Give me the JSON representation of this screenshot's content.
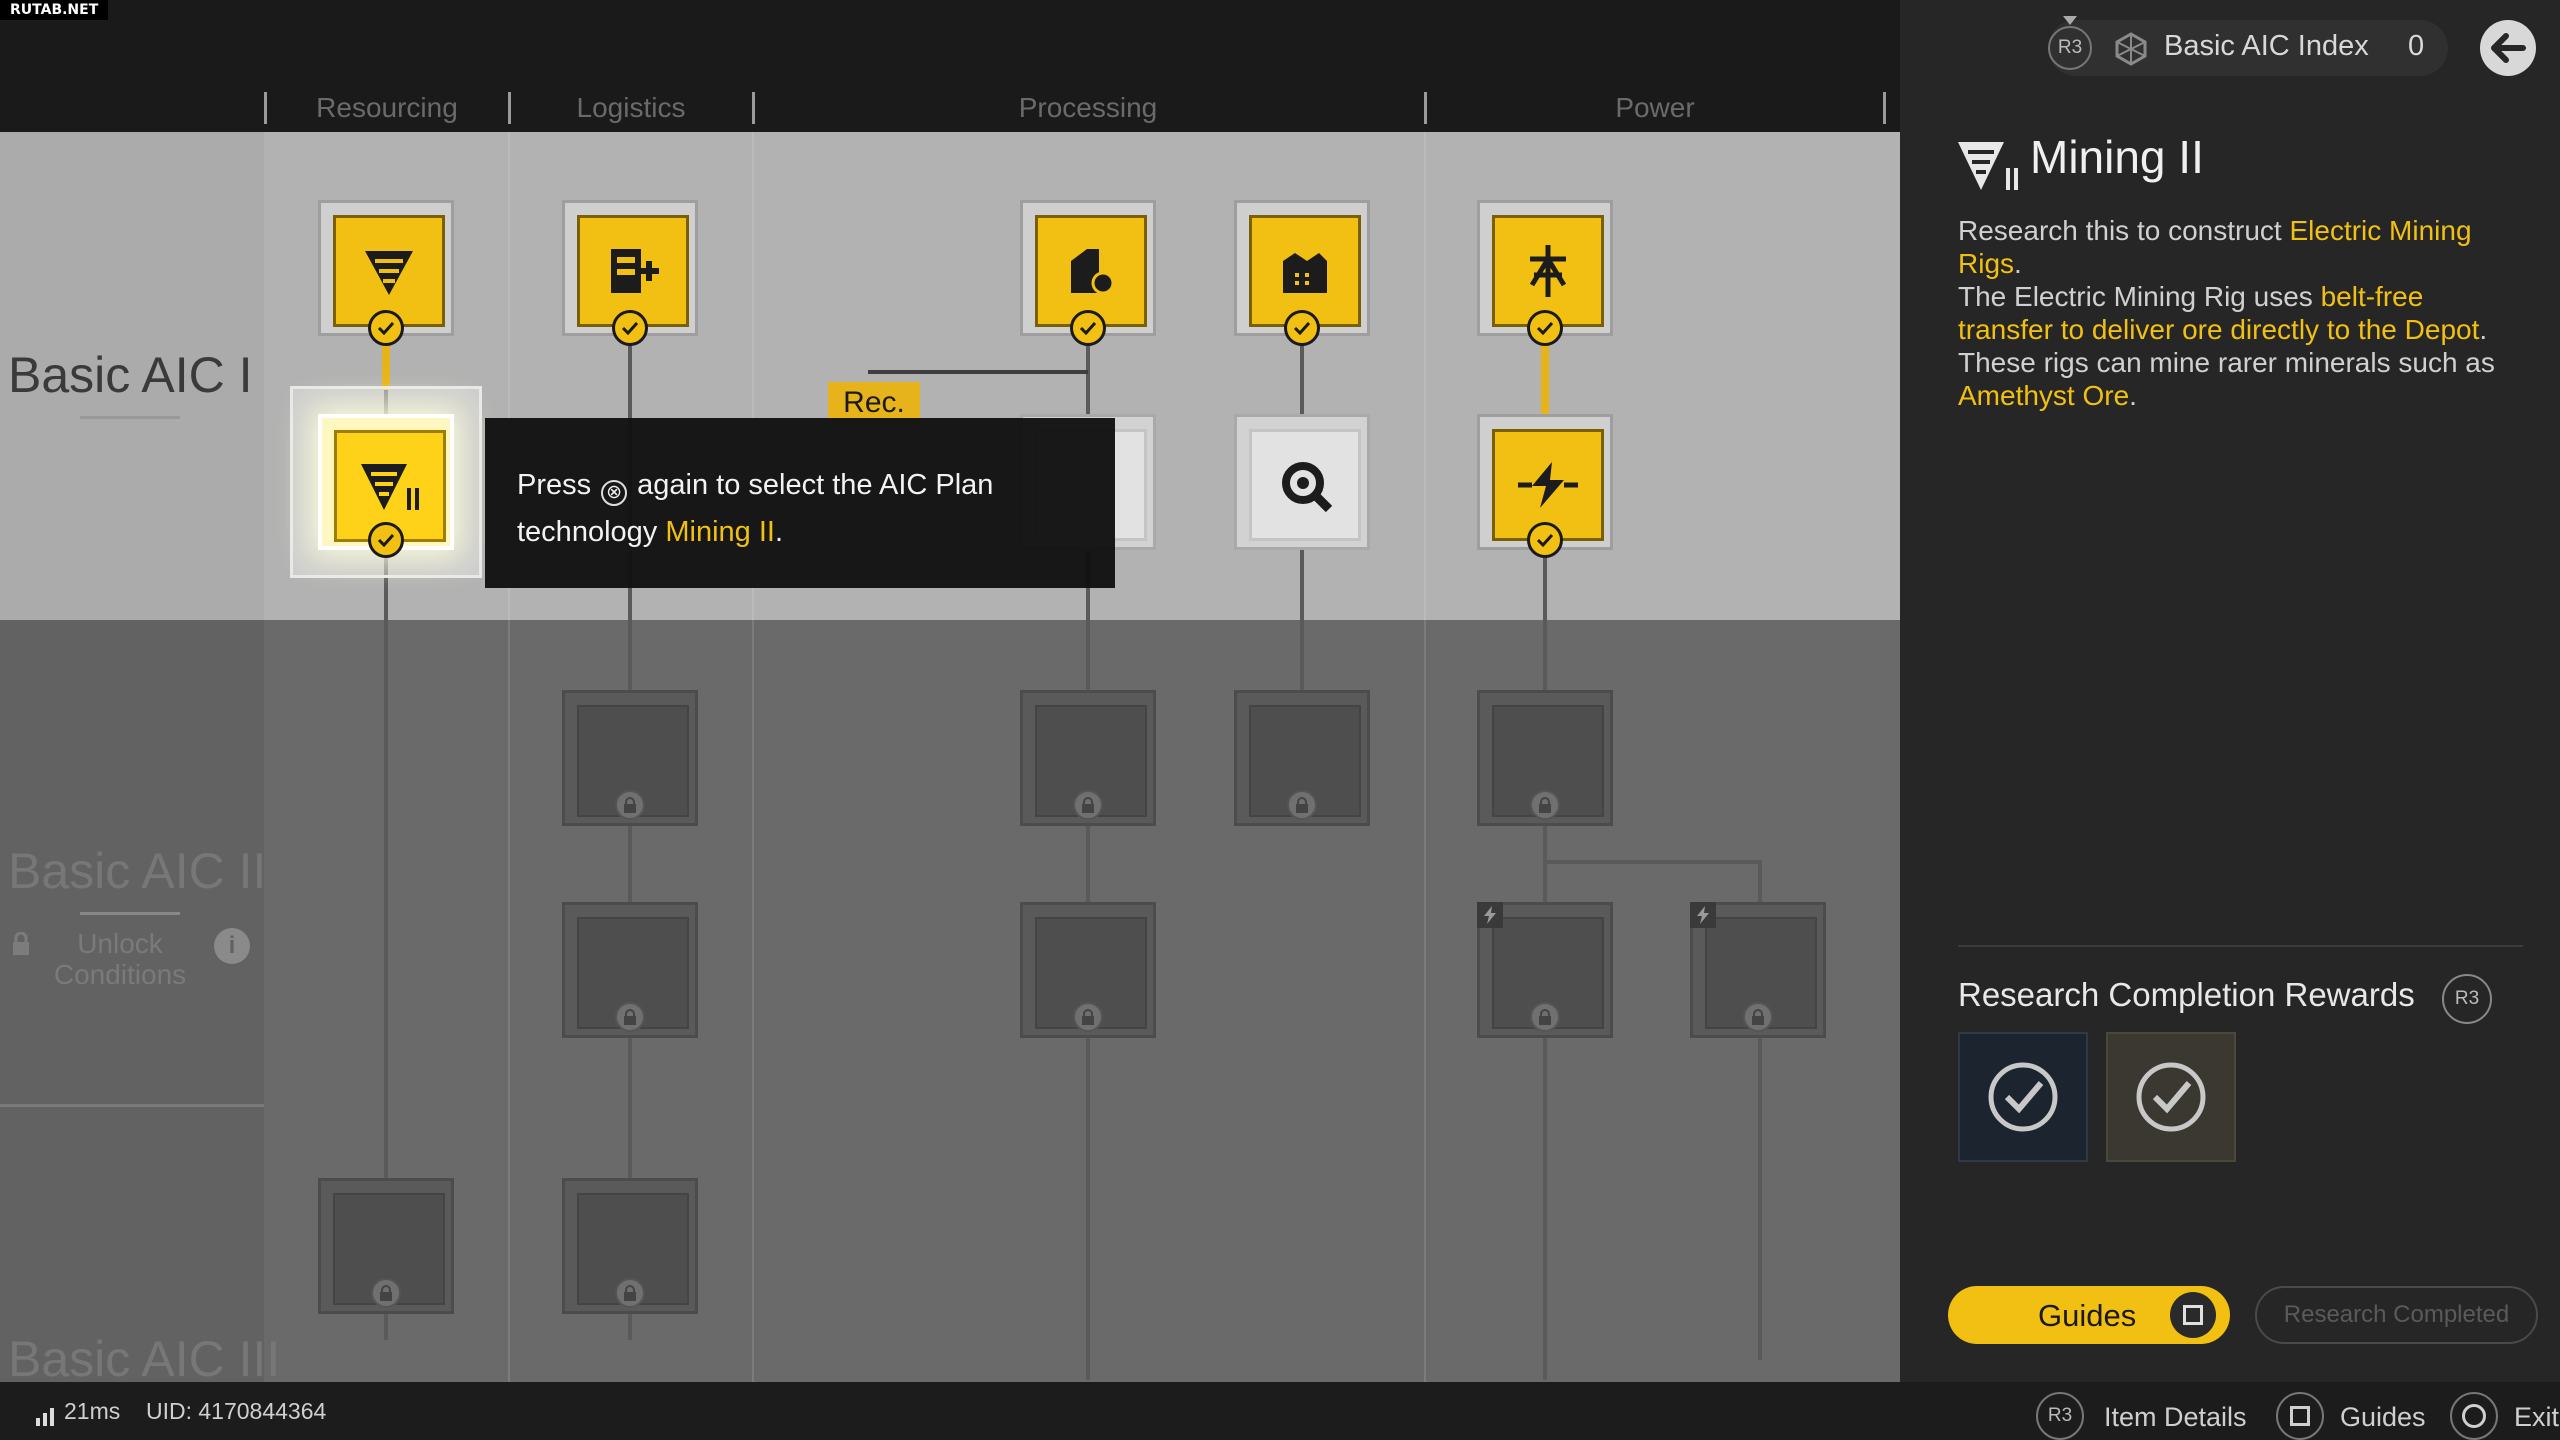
{
  "watermark": "RUTAB.NET",
  "categories": [
    "Resourcing",
    "Logistics",
    "Processing",
    "Power"
  ],
  "tiers": [
    "Basic AIC I",
    "Basic AIC II",
    "Basic AIC III"
  ],
  "unlock": {
    "line1": "Unlock",
    "line2": "Conditions",
    "info": "i"
  },
  "rec_tag": "Rec.",
  "tooltip": {
    "press": "Press",
    "button_glyph": "⊗",
    "again": "again to select the AIC Plan",
    "technology": "technology",
    "tech_name": "Mining II",
    "period": "."
  },
  "header": {
    "button": "R3",
    "index_label": "Basic AIC Index",
    "index_value": "0"
  },
  "panel": {
    "title": "Mining II",
    "desc": [
      {
        "t": "Research this to construct "
      },
      {
        "t": "Electric Mining Rigs",
        "hl": true
      },
      {
        "t": ".",
        "br": true
      },
      {
        "t": "The Electric Mining Rig uses "
      },
      {
        "t": "belt-free transfer to deliver ore directly to the Depot",
        "hl": true
      },
      {
        "t": ".",
        "br": true
      },
      {
        "t": "These rigs can mine rarer minerals such as "
      },
      {
        "t": "Amethyst Ore",
        "hl": true
      },
      {
        "t": "."
      }
    ],
    "rewards_title": "Research Completion Rewards",
    "rewards_button": "R3",
    "guides_label": "Guides",
    "completed_label": "Research Completed"
  },
  "status": {
    "ping": "21ms",
    "uid": "UID: 4170844364"
  },
  "hints": [
    {
      "key": "R3",
      "label": "Item Details"
    },
    {
      "key": "square",
      "label": "Guides"
    },
    {
      "key": "circle",
      "label": "Exit"
    }
  ],
  "colors": {
    "accent": "#f2c012",
    "panel_bg": "#262626",
    "tier1_bg": "#b2b2b2",
    "locked_bg": "#6a6a6a"
  }
}
